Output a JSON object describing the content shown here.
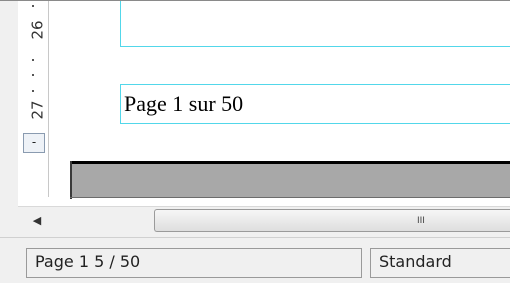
{
  "ruler": {
    "mark_26": "26",
    "mark_27": "27",
    "button_label": "-"
  },
  "document": {
    "footer_text": "Page 1 sur 50"
  },
  "scrollbar": {
    "left_arrow": "◀",
    "thumb_grip": "III"
  },
  "statusbar": {
    "page_label": "Page 1   5 / 50",
    "style_label": "Standard"
  }
}
